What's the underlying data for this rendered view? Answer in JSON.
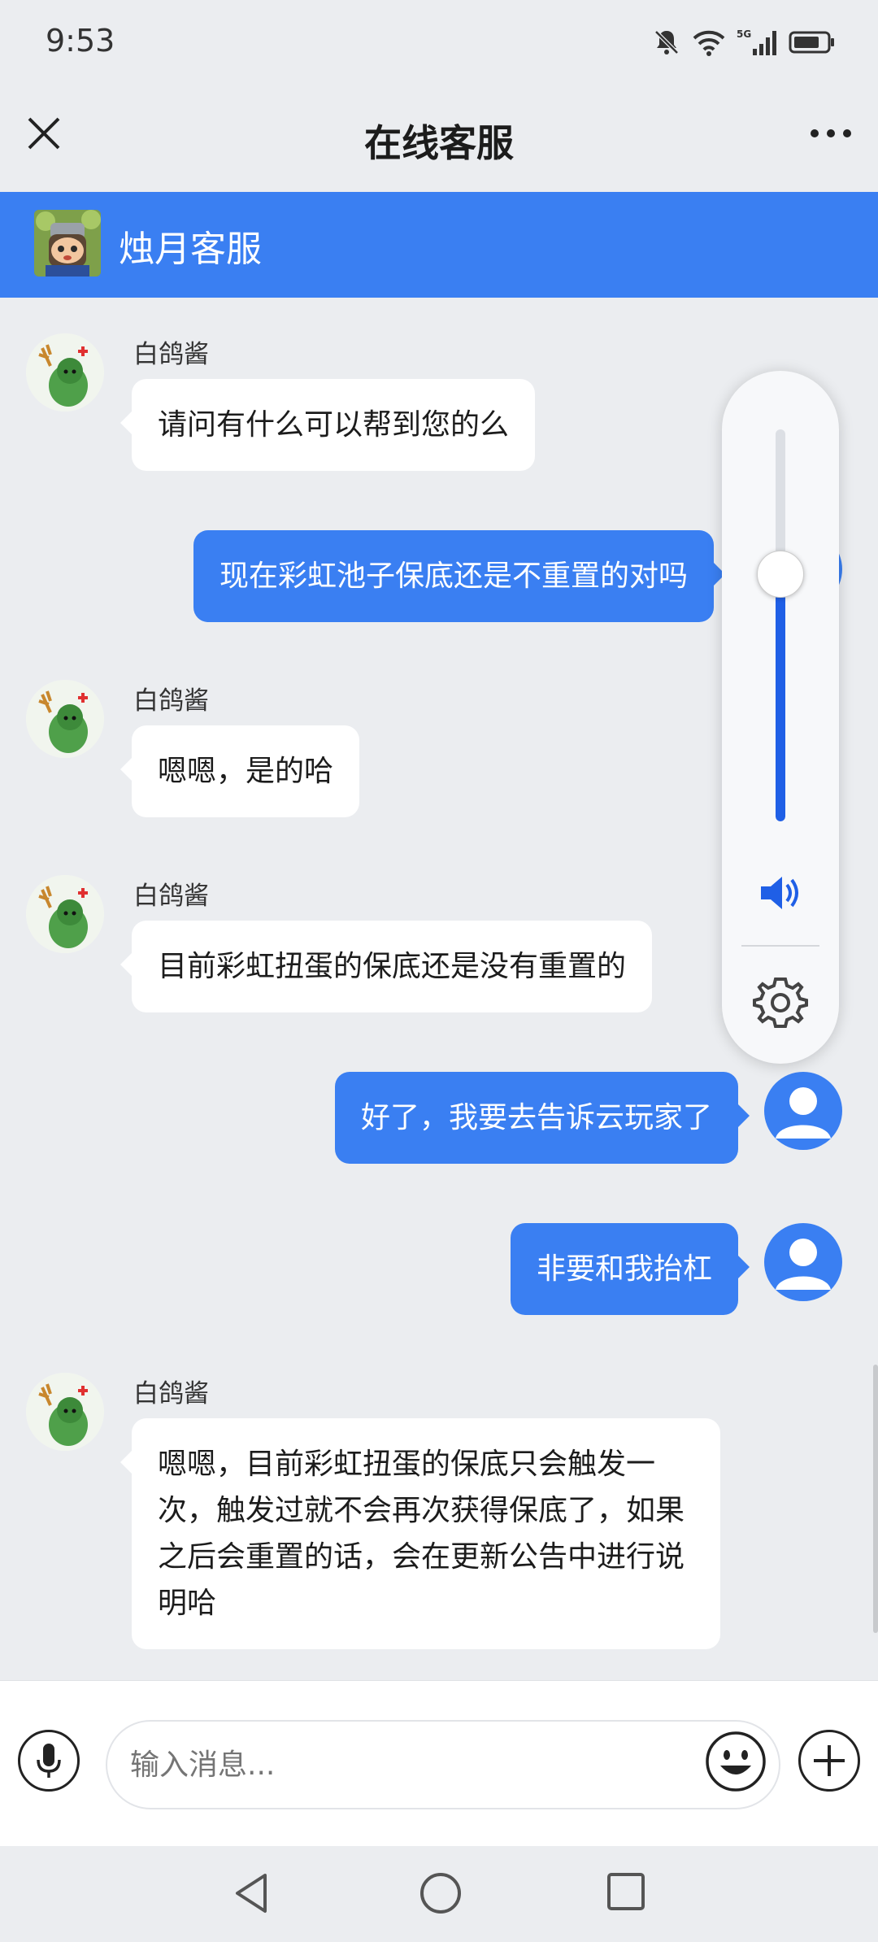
{
  "status_bar": {
    "time": "9:53",
    "icons": [
      "mute-bell-icon",
      "wifi-icon",
      "5g-signal-icon",
      "battery-icon"
    ],
    "network_label": "5G"
  },
  "header": {
    "title": "在线客服",
    "close_icon": "close-icon",
    "more_icon": "more-icon"
  },
  "service_bar": {
    "name": "烛月客服"
  },
  "messages": [
    {
      "direction": "in",
      "sender": "白鸽酱",
      "text": "请问有什么可以帮到您的么"
    },
    {
      "direction": "out",
      "text": "现在彩虹池子保底还是不重置的对吗"
    },
    {
      "direction": "in",
      "sender": "白鸽酱",
      "text": "嗯嗯，是的哈"
    },
    {
      "direction": "in",
      "sender": "白鸽酱",
      "text": "目前彩虹扭蛋的保底还是没有重置的"
    },
    {
      "direction": "out",
      "text": "好了，我要去告诉云玩家了"
    },
    {
      "direction": "out",
      "text": "非要和我抬杠"
    },
    {
      "direction": "in",
      "sender": "白鸽酱",
      "text": "嗯嗯，目前彩虹扭蛋的保底只会触发一次，触发过就不会再次获得保底了，如果之后会重置的话，会在更新公告中进行说明哈"
    }
  ],
  "volume_panel": {
    "level": 0.63,
    "speaker_icon": "speaker-icon",
    "settings_icon": "gear-icon"
  },
  "composer": {
    "placeholder": "输入消息...",
    "value": ""
  },
  "colors": {
    "accent": "#3a7ff2",
    "background": "#ebedf0",
    "volume_fill": "#1f5fe6"
  }
}
